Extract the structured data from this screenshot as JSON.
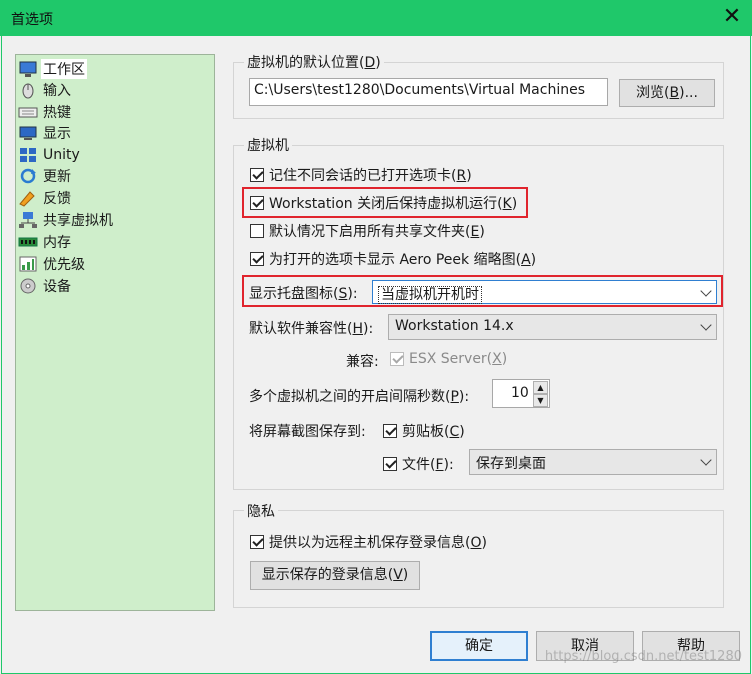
{
  "window": {
    "title": "首选项",
    "close_glyph": "✕"
  },
  "sidebar": {
    "items": [
      {
        "label": "工作区",
        "icon": "monitor-icon"
      },
      {
        "label": "输入",
        "icon": "mouse-icon"
      },
      {
        "label": "热键",
        "icon": "keyboard-icon"
      },
      {
        "label": "显示",
        "icon": "display-icon"
      },
      {
        "label": "Unity",
        "icon": "unity-icon"
      },
      {
        "label": "更新",
        "icon": "update-icon"
      },
      {
        "label": "反馈",
        "icon": "feedback-icon"
      },
      {
        "label": "共享虚拟机",
        "icon": "shared-vm-icon"
      },
      {
        "label": "内存",
        "icon": "memory-icon"
      },
      {
        "label": "优先级",
        "icon": "priority-icon"
      },
      {
        "label": "设备",
        "icon": "device-icon"
      }
    ],
    "selected": "工作区"
  },
  "default_location": {
    "group_title_pre": "虚拟机的默认位置(",
    "group_title_key": "D",
    "group_title_post": ")",
    "path": "C:\\Users\\test1280\\Documents\\Virtual Machines",
    "browse_pre": "浏览(",
    "browse_key": "B",
    "browse_post": ")..."
  },
  "vm_group": {
    "title": "虚拟机",
    "remember_tabs": {
      "pre": "记住不同会话的已打开选项卡(",
      "key": "R",
      "post": ")",
      "checked": true
    },
    "keep_running": {
      "pre": "Workstation 关闭后保持虚拟机运行(",
      "key": "K",
      "post": ")",
      "checked": true
    },
    "enable_shared": {
      "pre": "默认情况下启用所有共享文件夹(",
      "key": "E",
      "post": ")",
      "checked": false
    },
    "aero_peek": {
      "pre": "为打开的选项卡显示 Aero Peek 缩略图(",
      "key": "A",
      "post": ")",
      "checked": true
    },
    "tray_icon": {
      "label_pre": "显示托盘图标(",
      "label_key": "S",
      "label_post": "):",
      "value": "当虚拟机开机时"
    },
    "compat": {
      "label_pre": "默认软件兼容性(",
      "label_key": "H",
      "label_post": "):",
      "value": "Workstation 14.x"
    },
    "compat_with": {
      "label": "兼容:",
      "pre": "ESX Server(",
      "key": "X",
      "post": ")",
      "checked": true
    },
    "interval": {
      "label_pre": "多个虚拟机之间的开启间隔秒数(",
      "label_key": "P",
      "label_post": "):",
      "value": "10",
      "up": "▲",
      "down": "▼"
    },
    "screenshot": {
      "label": "将屏幕截图保存到:",
      "clipboard": {
        "pre": "剪贴板(",
        "key": "C",
        "post": ")",
        "checked": true
      },
      "file": {
        "pre": "文件(",
        "key": "F",
        "post": "):",
        "checked": true
      },
      "file_value": "保存到桌面"
    }
  },
  "privacy": {
    "title": "隐私",
    "save_login": {
      "pre": "提供以为远程主机保存登录信息(",
      "key": "O",
      "post": ")",
      "checked": true
    },
    "show_saved_pre": "显示保存的登录信息(",
    "show_saved_key": "V",
    "show_saved_post": ")"
  },
  "buttons": {
    "ok": "确定",
    "cancel": "取消",
    "help": "帮助"
  },
  "watermark": "https://blog.csdn.net/test1280",
  "colors": {
    "titlebar": "#1fc86a",
    "sidebar": "#cfeecb",
    "highlight_box": "#e0242d"
  }
}
